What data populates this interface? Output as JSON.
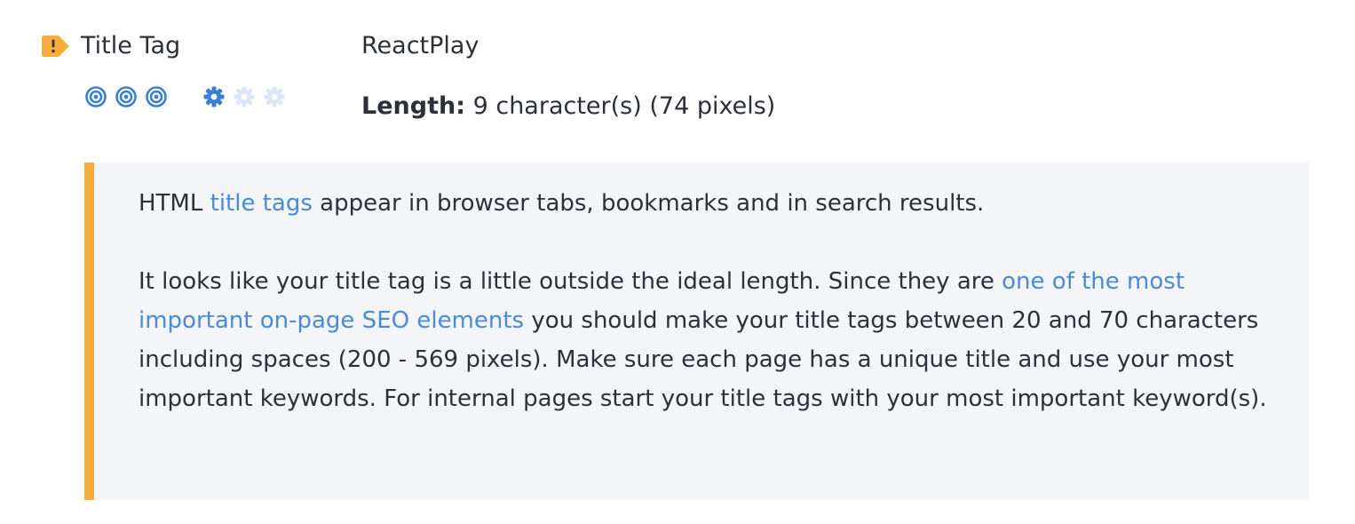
{
  "check": {
    "title": "Title Tag",
    "status": "warning",
    "status_icon": "exclamation-tag-icon",
    "status_color": "#f8ad3c",
    "value": "ReactPlay"
  },
  "ratings": {
    "importance": {
      "icon": "target-icon",
      "level": 3,
      "max": 3,
      "active_color": "#3a7fd6"
    },
    "difficulty": {
      "icon": "gear-icon",
      "level": 1,
      "max": 3,
      "active_color": "#3a7fd6",
      "inactive_color": "#dbe7f6"
    }
  },
  "length": {
    "label": "Length:",
    "value": "9 character(s) (74 pixels)"
  },
  "info": {
    "accent_color": "#f8ad3c",
    "link_color": "#4a8ad6",
    "p1": {
      "before": "HTML ",
      "link": "title tags",
      "after": " appear in browser tabs, bookmarks and in search results."
    },
    "p2": {
      "before": "It looks like your title tag is a little outside the ideal length. Since they are ",
      "link": "one of the most important on-page SEO elements",
      "after": " you should make your title tags between 20 and 70 characters including spaces (200 - 569 pixels). Make sure each page has a unique title and use your most important keywords. For internal pages start your title tags with your most important keyword(s)."
    }
  }
}
